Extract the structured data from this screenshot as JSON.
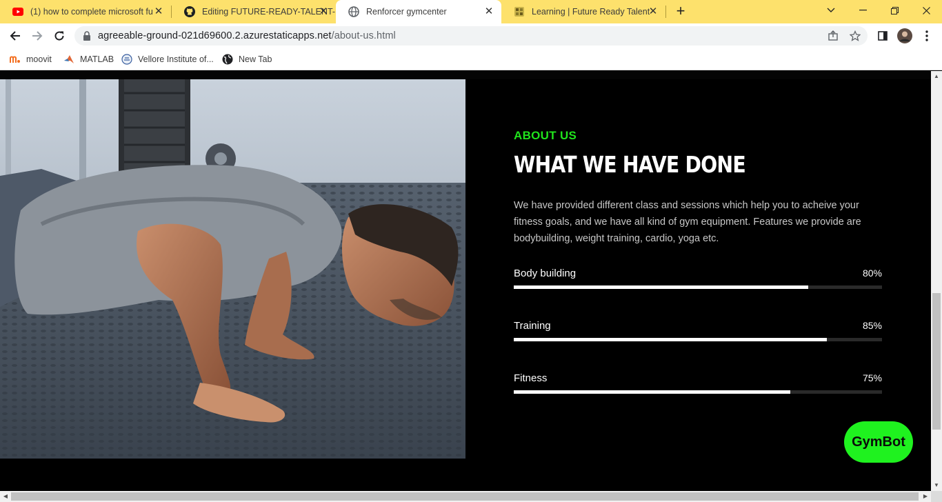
{
  "browser": {
    "tabs": [
      {
        "title": "(1) how to complete microsoft fu",
        "icon": "youtube-icon",
        "active": false
      },
      {
        "title": "Editing FUTURE-READY-TALENT-",
        "icon": "github-icon",
        "active": false
      },
      {
        "title": "Renforcer gymcenter",
        "icon": "globe-icon",
        "active": true
      },
      {
        "title": "Learning | Future Ready Talent",
        "icon": "frt-logo-icon",
        "active": false
      }
    ],
    "new_tab_label": "+",
    "address": {
      "host": "agreeable-ground-021d69600.2.azurestaticapps.net",
      "path": "/about-us.html"
    },
    "bookmarks": [
      {
        "label": "moovit",
        "icon": "moovit-icon"
      },
      {
        "label": "MATLAB",
        "icon": "matlab-icon"
      },
      {
        "label": "Vellore Institute of...",
        "icon": "vit-icon"
      },
      {
        "label": "New Tab",
        "icon": "globe-icon"
      }
    ],
    "colors": {
      "tabstrip": "#fde16c",
      "accent": "#1ff21f"
    }
  },
  "about": {
    "eyebrow": "ABOUT US",
    "heading": "WHAT WE HAVE DONE",
    "description": "We have provided different class and sessions which help you to acheive your fitness goals, and we have all kind of gym equipment. Features we provide are bodybuilding, weight training, cardio, yoga etc.",
    "skills": [
      {
        "name": "Body building",
        "percent_label": "80%",
        "value": 0.8
      },
      {
        "name": "Training",
        "percent_label": "85%",
        "value": 0.85
      },
      {
        "name": "Fitness",
        "percent_label": "75%",
        "value": 0.75
      }
    ],
    "image": "man-doing-pushups-photo"
  },
  "chatbot": {
    "label": "GymBot"
  }
}
